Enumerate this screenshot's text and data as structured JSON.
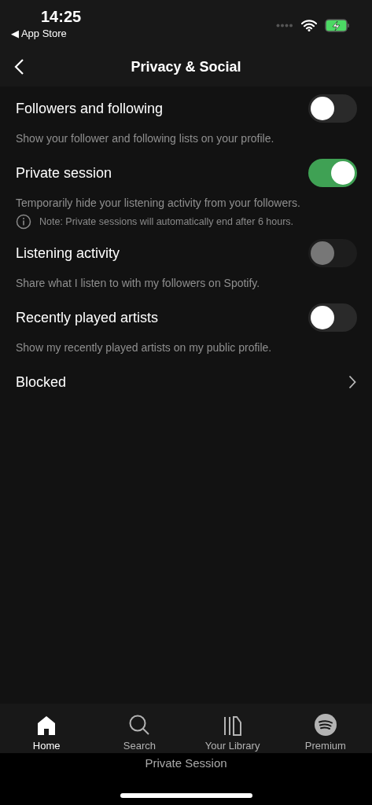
{
  "status_bar": {
    "time": "14:25",
    "back_app": "◀ App Store"
  },
  "header": {
    "title": "Privacy & Social"
  },
  "settings": [
    {
      "kind": "toggle",
      "label": "Followers and following",
      "on": false,
      "disabled": false,
      "description": "Show your follower and following lists on your profile."
    },
    {
      "kind": "toggle",
      "label": "Private session",
      "on": true,
      "disabled": false,
      "description": "Temporarily hide your listening activity from your followers.",
      "note": "Note: Private sessions will automatically end after 6 hours."
    },
    {
      "kind": "toggle",
      "label": "Listening activity",
      "on": false,
      "disabled": true,
      "description": "Share what I listen to with my followers on Spotify."
    },
    {
      "kind": "toggle",
      "label": "Recently played artists",
      "on": false,
      "disabled": false,
      "description": "Show my recently played artists on my public profile."
    },
    {
      "kind": "link",
      "label": "Blocked"
    }
  ],
  "tab_bar": [
    {
      "kind": "home",
      "label": "Home",
      "selected": true
    },
    {
      "kind": "search",
      "label": "Search",
      "selected": false
    },
    {
      "kind": "library",
      "label": "Your Library",
      "selected": false
    },
    {
      "kind": "premium",
      "label": "Premium",
      "selected": false
    }
  ],
  "session_banner": "Private Session"
}
